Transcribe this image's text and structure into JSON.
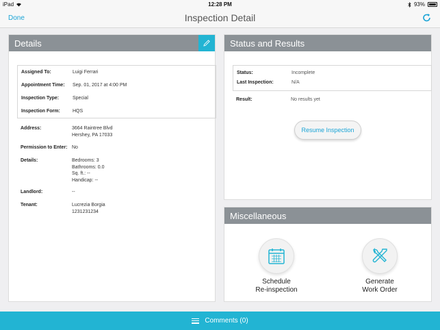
{
  "status_bar": {
    "device": "iPad",
    "time": "12:28 PM",
    "battery": "93%"
  },
  "nav": {
    "done": "Done",
    "title": "Inspection Detail"
  },
  "details_panel": {
    "title": "Details",
    "box_rows": [
      {
        "label": "Assigned To:",
        "value": "Luigi Ferrari"
      },
      {
        "label": "Appointment Time:",
        "value": "Sep. 01, 2017 at 4:00 PM"
      },
      {
        "label": "Inspection Type:",
        "value": "Special"
      },
      {
        "label": "Inspection Form:",
        "value": "HQS"
      }
    ],
    "address": {
      "label": "Address:",
      "line1": "3664 Raintree Blvd",
      "line2": "Hershey, PA 17033"
    },
    "permission": {
      "label": "Permission to Enter:",
      "value": "No"
    },
    "details": {
      "label": "Details:",
      "line1": "Bedrooms: 3",
      "line2": "Bathrooms: 0.0",
      "line3": "Sq. ft.: --",
      "line4": "Handicap: --"
    },
    "landlord": {
      "label": "Landlord:",
      "value": "--"
    },
    "tenant": {
      "label": "Tenant:",
      "line1": "Lucrezia Borgia",
      "line2": "1231231234"
    }
  },
  "status_panel": {
    "title": "Status and Results",
    "status": {
      "label": "Status:",
      "value": "Incomplete"
    },
    "last_inspection": {
      "label": "Last Inspection:",
      "value": "N/A"
    },
    "result": {
      "label": "Result:",
      "value": "No results yet"
    },
    "resume_button": "Resume Inspection"
  },
  "misc_panel": {
    "title": "Miscellaneous",
    "schedule": {
      "line1": "Schedule",
      "line2": "Re-inspection",
      "icon": "calendar-icon"
    },
    "work_order": {
      "line1": "Generate",
      "line2": "Work Order",
      "icon": "tools-icon"
    }
  },
  "comments": {
    "label": "Comments (0)"
  },
  "colors": {
    "accent": "#22b4d3",
    "header_gray": "#8b9196",
    "link_blue": "#1aa4d6"
  }
}
